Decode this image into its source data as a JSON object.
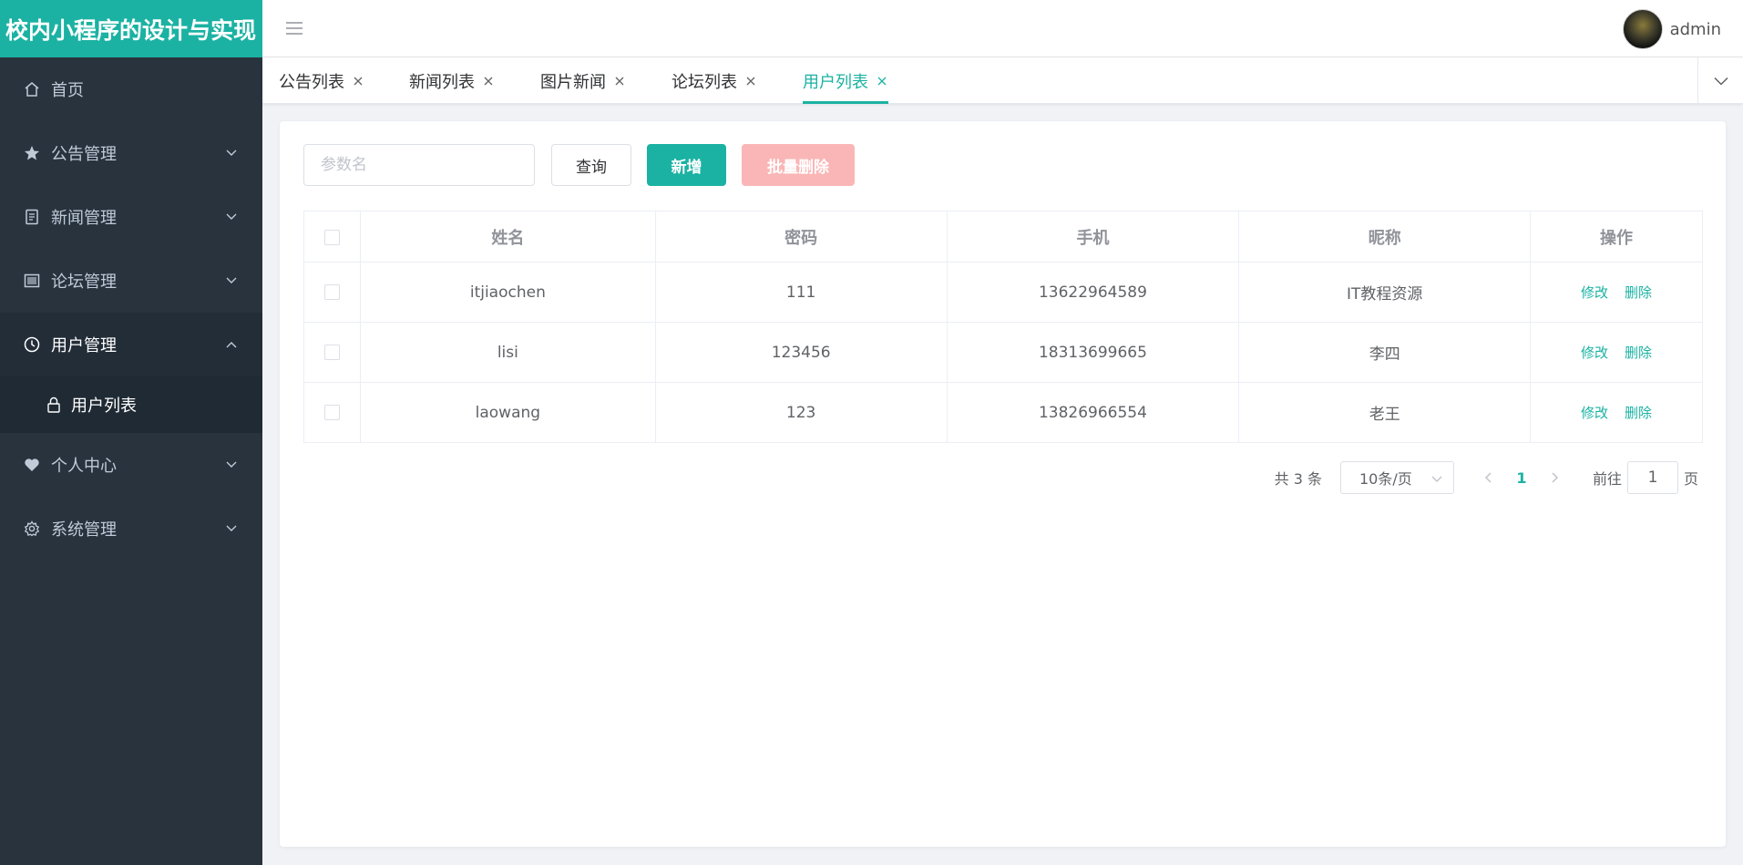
{
  "app": {
    "title": "校内小程序的设计与实现",
    "brand_color": "#1bb2a3",
    "sidebar_bg": "#28333e"
  },
  "sidebar": {
    "items": [
      {
        "label": "首页",
        "icon": "home-icon"
      },
      {
        "label": "公告管理",
        "icon": "star-icon"
      },
      {
        "label": "新闻管理",
        "icon": "document-icon"
      },
      {
        "label": "论坛管理",
        "icon": "picture-icon"
      },
      {
        "label": "用户管理",
        "icon": "clock-icon",
        "expanded": true
      },
      {
        "label": "个人中心",
        "icon": "heart-icon"
      },
      {
        "label": "系统管理",
        "icon": "gear-icon"
      }
    ],
    "submenu": {
      "label": "用户列表",
      "icon": "lock-icon"
    }
  },
  "header": {
    "username": "admin"
  },
  "tabs": [
    {
      "label": "公告列表"
    },
    {
      "label": "新闻列表"
    },
    {
      "label": "图片新闻"
    },
    {
      "label": "论坛列表"
    },
    {
      "label": "用户列表",
      "active": true
    }
  ],
  "toolbar": {
    "search_placeholder": "参数名",
    "query_label": "查询",
    "add_label": "新增",
    "batch_delete_label": "批量删除"
  },
  "table": {
    "columns": [
      "姓名",
      "密码",
      "手机",
      "昵称",
      "操作"
    ],
    "rows": [
      {
        "name": "itjiaochen",
        "password": "111",
        "phone": "13622964589",
        "nickname": "IT教程资源"
      },
      {
        "name": "lisi",
        "password": "123456",
        "phone": "18313699665",
        "nickname": "李四"
      },
      {
        "name": "laowang",
        "password": "123",
        "phone": "13826966554",
        "nickname": "老王"
      }
    ],
    "edit_label": "修改",
    "delete_label": "删除"
  },
  "pagination": {
    "total_text": "共 3 条",
    "page_size": "10条/页",
    "current_page": "1",
    "goto_label": "前往",
    "goto_value": "1",
    "goto_suffix": "页"
  }
}
